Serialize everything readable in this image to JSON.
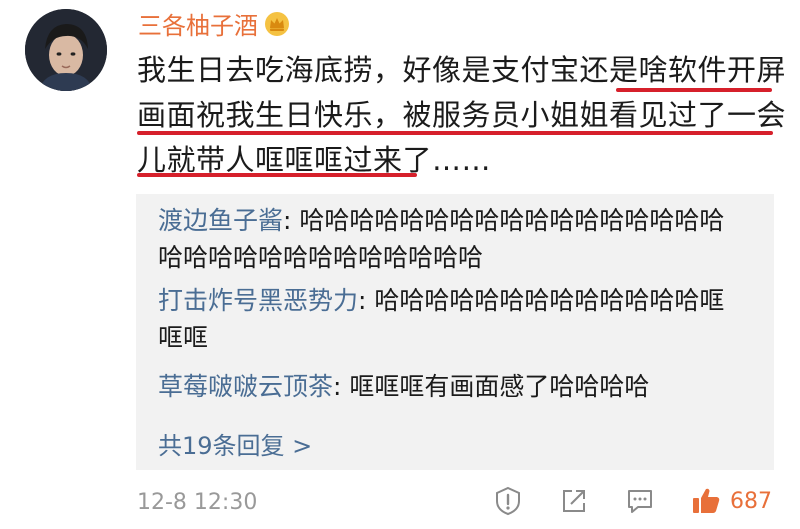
{
  "post": {
    "username": "三各柚子酒",
    "content_line1": "我生日去吃海底捞，好像是支付宝还是啥软件开屏",
    "content_line2": "画面祝我生日快乐，被服务员小姐姐看见过了一会",
    "content_line3": "儿就带人哐哐哐过来了……"
  },
  "replies": [
    {
      "name": "渡边鱼子酱",
      "sep": ": ",
      "text": "哈哈哈哈哈哈哈哈哈哈哈哈哈哈哈哈哈",
      "text2": "哈哈哈哈哈哈哈哈哈哈哈哈哈"
    },
    {
      "name": "打击炸号黑恶势力",
      "sep": ": ",
      "text": "哈哈哈哈哈哈哈哈哈哈哈哈哈哐",
      "text2": "哐哐"
    },
    {
      "name": "草莓啵啵云顶茶",
      "sep": ": ",
      "text": "哐哐哐有画面感了哈哈哈哈",
      "text2": ""
    }
  ],
  "more_replies": "共19条回复 >",
  "footer": {
    "time": "12-8 12:30",
    "like_count": "687"
  },
  "colors": {
    "username": "#e8703a",
    "reply_name": "#4a6d94",
    "underline": "#d6202b",
    "panel": "#f2f2f2"
  },
  "icons": [
    "crown-badge-icon",
    "report-icon",
    "share-icon",
    "comment-icon",
    "like-icon"
  ]
}
